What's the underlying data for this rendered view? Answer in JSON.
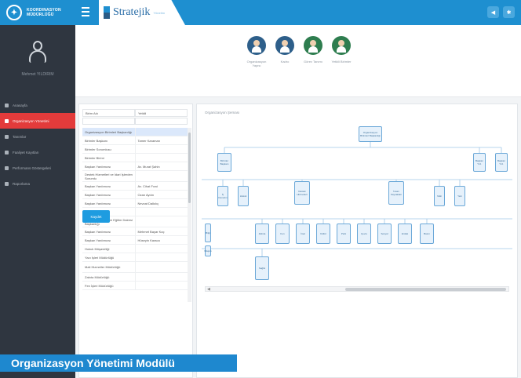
{
  "brand": {
    "name_line1": "KOORDINASYON",
    "name_line2": "MÜDÜRLÜĞÜ"
  },
  "topbar": {
    "logo_text": "Stratejik",
    "logo_sub": "Yönetim"
  },
  "user": {
    "name": "Mehmet YILDIRIM"
  },
  "nav": {
    "items": [
      {
        "label": "Anasayfa",
        "active": false
      },
      {
        "label": "Organizasyon Yönetimi",
        "active": true
      },
      {
        "label": "Tanımlar",
        "active": false
      },
      {
        "label": "Faaliyet Kayıtları",
        "active": false
      },
      {
        "label": "Performans Göstergeleri",
        "active": false
      },
      {
        "label": "Raporlama",
        "active": false
      }
    ]
  },
  "roles": [
    {
      "label": "Organizasyon Yapısı",
      "color": "#2e5f8a"
    },
    {
      "label": "Kadro",
      "color": "#2e5f8a"
    },
    {
      "label": "Görev Tanımı",
      "color": "#2e7d4f"
    },
    {
      "label": "Yetkili Birimler",
      "color": "#2e7d4f"
    }
  ],
  "table": {
    "headers": [
      "Birim Adı",
      "Yetkili"
    ],
    "rows": [
      [
        "Organizasyon Birimleri Başkanlığı",
        "",
        "sel"
      ],
      [
        "Birimler Başkanı",
        "Tamer Karaman",
        ""
      ],
      [
        "Birimler Sorumlusu",
        "",
        ""
      ],
      [
        "Birimler Birimi",
        "",
        ""
      ],
      [
        "Başkan Yardımcısı",
        "Av. Murat Şahin",
        ""
      ],
      [
        "Destek Hizmetleri ve İdari İşlerden Sorumlu",
        "",
        "tall"
      ],
      [
        "Başkan Yardımcısı",
        "Av. Cihat Fırat",
        ""
      ],
      [
        "Başkan Yardımcısı",
        "Ozan Aydın",
        ""
      ],
      [
        "Başkan Yardımcısı",
        "Nevzat Dalkılıç",
        ""
      ],
      [
        "İç Denetçi Birimi",
        "",
        ""
      ],
      [
        "İnsan Kaynakları ve Eğitim Dairesi Başkanlığı",
        "",
        "tall"
      ],
      [
        "Başkan Yardımcısı",
        "Mehmet Bayar Koç",
        ""
      ],
      [
        "Başkan Yardımcısı",
        "Hüseyin Karaca",
        ""
      ],
      [
        "Hukuk Müşavirliği",
        "",
        ""
      ],
      [
        "Yazı İşleri Müdürlüğü",
        "",
        ""
      ],
      [
        "Mali Hizmetler Müdürlüğü",
        "",
        "tall"
      ],
      [
        "Zabıta Müdürlüğü",
        "",
        ""
      ],
      [
        "Fen İşleri Müdürlüğü",
        "",
        ""
      ]
    ]
  },
  "save_button": "Kaydet",
  "chart": {
    "title": "Organizasyon Şeması",
    "nodes": [
      {
        "label": "Organizasyon Birimleri Başkanlığı"
      },
      {
        "label": "Birimler Başkanı"
      },
      {
        "label": "Başkan Yrd."
      },
      {
        "label": "Başkan Yrd."
      },
      {
        "label": "İç Denetim"
      },
      {
        "label": "Hukuk"
      },
      {
        "label": "Destek Hizmetleri"
      },
      {
        "label": "İnsan Kaynakları"
      },
      {
        "label": "Mali"
      },
      {
        "label": "Yazı"
      },
      {
        "label": "Bilgi"
      },
      {
        "label": "Zabıta"
      },
      {
        "label": "Fen"
      },
      {
        "label": "İmar"
      },
      {
        "label": "Kültür"
      },
      {
        "label": "Park"
      },
      {
        "label": "Çevre"
      },
      {
        "label": "Sosyal"
      },
      {
        "label": "Emlak"
      },
      {
        "label": "Basın"
      },
      {
        "label": "Ulaşım"
      },
      {
        "label": "Sağlık"
      },
      {
        "label": "Teftiş Kurulu"
      },
      {
        "label": "Plan"
      }
    ]
  },
  "caption": "Organizasyon Yönetimi Modülü"
}
